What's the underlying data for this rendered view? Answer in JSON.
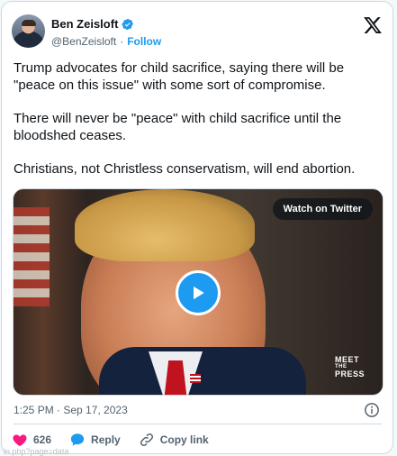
{
  "author": {
    "name": "Ben Zeisloft",
    "handle": "@BenZeisloft",
    "separator": "·",
    "follow_label": "Follow"
  },
  "tweet": {
    "paragraphs": [
      "Trump advocates for child sacrifice, saying there will be \"peace on this issue\" with some sort of compromise.",
      "There will never be \"peace\" with child sacrifice until the bloodshed ceases.",
      "Christians, not Christless conservatism, will end abortion."
    ]
  },
  "media": {
    "watch_label": "Watch on Twitter",
    "brand_line1": "MEET",
    "brand_line2": "THE",
    "brand_line3": "PRESS"
  },
  "meta": {
    "timestamp": "1:25 PM · Sep 17, 2023"
  },
  "actions": {
    "like_count": "626",
    "reply_label": "Reply",
    "copy_label": "Copy link"
  },
  "footer": {
    "url_text": "in.php?page=data"
  },
  "colors": {
    "accent": "#1d9bf0",
    "like": "#f91880",
    "text": "#0f1419",
    "muted": "#536471"
  },
  "icons": [
    "verified-badge-icon",
    "x-logo-icon",
    "play-icon",
    "info-icon",
    "heart-icon",
    "reply-icon",
    "link-icon"
  ]
}
